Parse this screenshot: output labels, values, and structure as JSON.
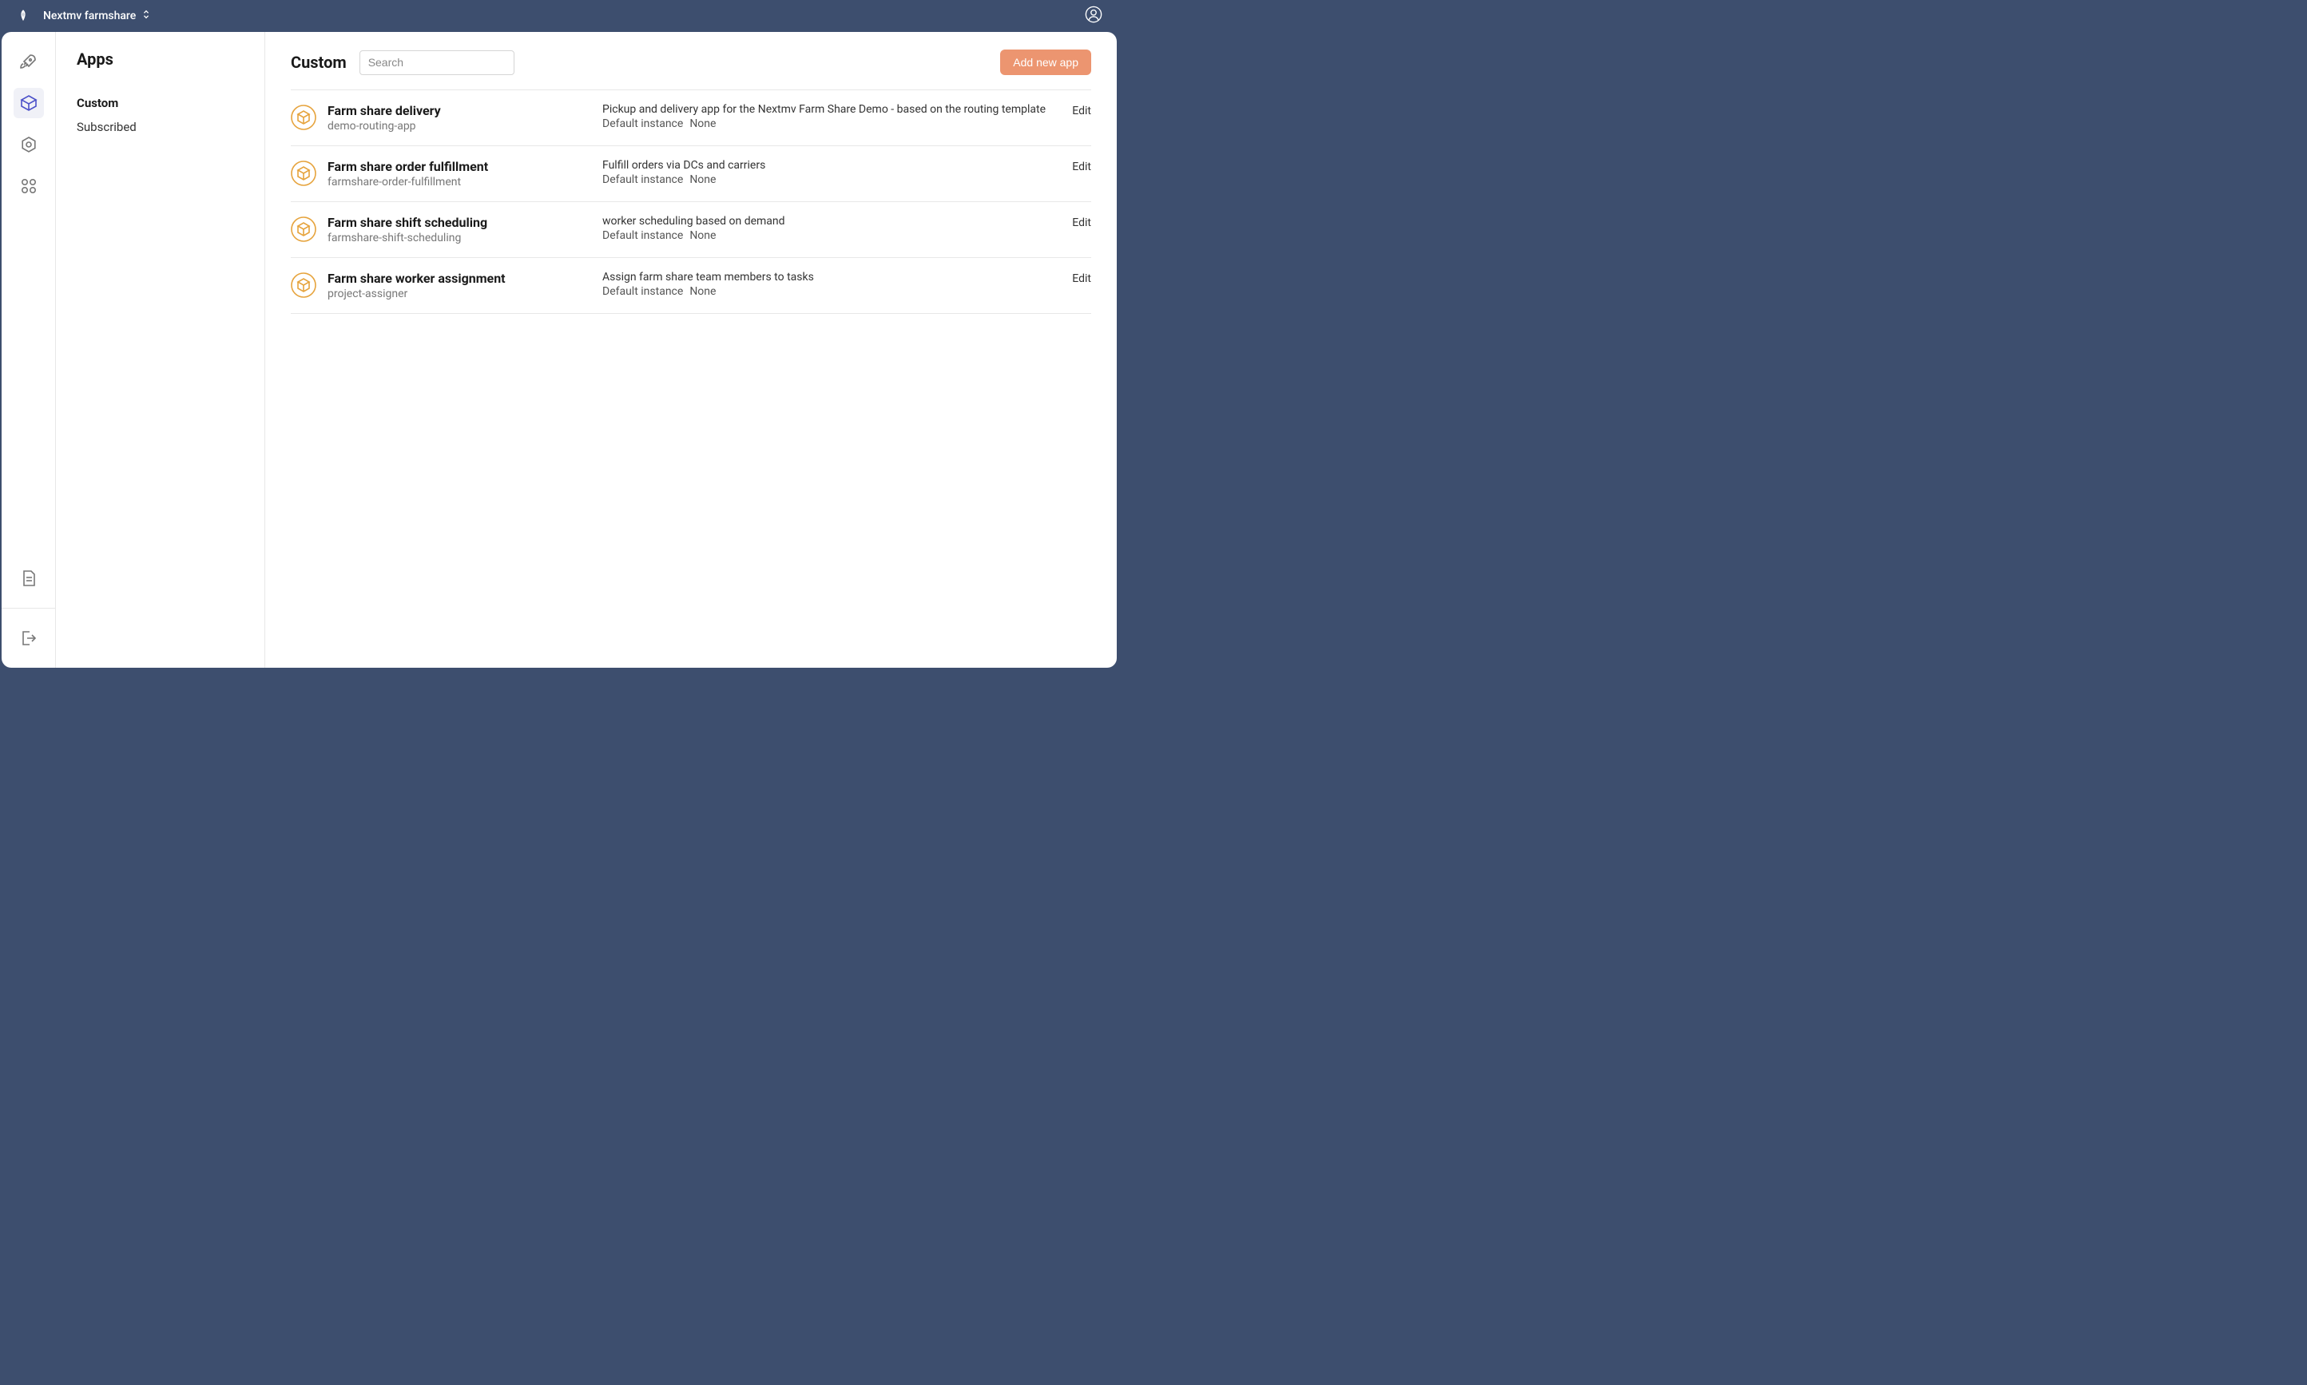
{
  "topbar": {
    "org_name": "Nextmv farmshare"
  },
  "subnav": {
    "title": "Apps",
    "items": [
      {
        "label": "Custom",
        "active": true
      },
      {
        "label": "Subscribed",
        "active": false
      }
    ]
  },
  "main": {
    "title": "Custom",
    "search_placeholder": "Search",
    "add_button_label": "Add new app",
    "default_instance_label": "Default instance",
    "edit_label": "Edit",
    "apps": [
      {
        "name": "Farm share delivery",
        "id": "demo-routing-app",
        "description": "Pickup and delivery app for the Nextmv Farm Share Demo - based on the routing template",
        "default_instance": "None"
      },
      {
        "name": "Farm share order fulfillment",
        "id": "farmshare-order-fulfillment",
        "description": "Fulfill orders via DCs and carriers",
        "default_instance": "None"
      },
      {
        "name": "Farm share shift scheduling",
        "id": "farmshare-shift-scheduling",
        "description": "worker scheduling based on demand",
        "default_instance": "None"
      },
      {
        "name": "Farm share worker assignment",
        "id": "project-assigner",
        "description": "Assign farm share team members to tasks",
        "default_instance": "None"
      }
    ]
  }
}
